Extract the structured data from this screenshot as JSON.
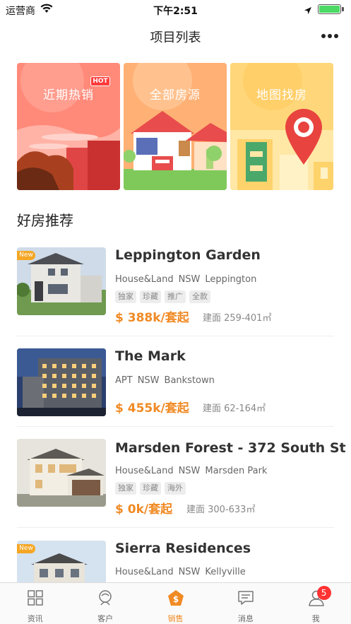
{
  "status_bar": {
    "carrier": "运营商",
    "time": "下午2:51"
  },
  "nav": {
    "title": "项目列表"
  },
  "banners": [
    {
      "title": "近期热销",
      "badge": "HOT"
    },
    {
      "title": "全部房源"
    },
    {
      "title": "地图找房"
    }
  ],
  "section_title": "好房推荐",
  "listings": [
    {
      "badge": "New",
      "name": "Leppington Garden",
      "meta": [
        "House&Land",
        "NSW",
        "Leppington"
      ],
      "tags": [
        "独家",
        "珍藏",
        "推广",
        "全款"
      ],
      "price": "$ 388k/套起",
      "area": "建面 259-401㎡"
    },
    {
      "name": "The Mark",
      "meta": [
        "APT",
        "NSW",
        "Bankstown"
      ],
      "tags": [],
      "price": "$ 455k/套起",
      "area": "建面 62-164㎡"
    },
    {
      "name": "Marsden Forest - 372 South St",
      "meta": [
        "House&Land",
        "NSW",
        "Marsden Park"
      ],
      "tags": [
        "独家",
        "珍藏",
        "海外"
      ],
      "price": "$ 0k/套起",
      "area": "建面 300-633㎡"
    },
    {
      "badge": "New",
      "name": "Sierra Residences",
      "meta": [
        "House&Land",
        "NSW",
        "Kellyville"
      ]
    }
  ],
  "tabs": [
    {
      "label": "资讯",
      "icon": "grid-icon"
    },
    {
      "label": "客户",
      "icon": "customer-icon"
    },
    {
      "label": "销售",
      "icon": "sales-icon",
      "active": true
    },
    {
      "label": "消息",
      "icon": "message-icon"
    },
    {
      "label": "我",
      "icon": "profile-icon",
      "badge": "5"
    }
  ],
  "colors": {
    "accent": "#f08a24",
    "badge_red": "#ff3333",
    "new_badge": "#f5a623"
  }
}
